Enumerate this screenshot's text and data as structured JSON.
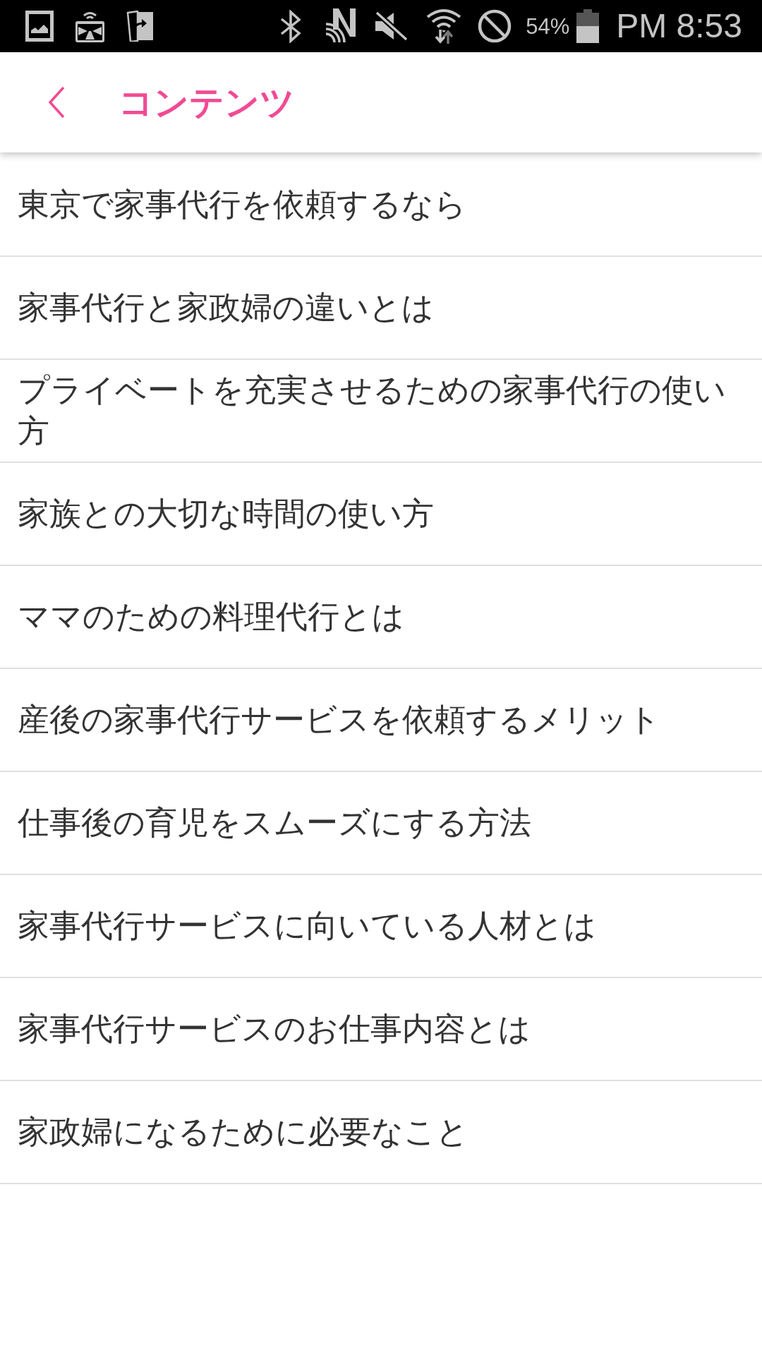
{
  "status_bar": {
    "battery_text": "54%",
    "time": "PM 8:53"
  },
  "header": {
    "title": "コンテンツ"
  },
  "items": [
    {
      "title": "東京で家事代行を依頼するなら"
    },
    {
      "title": "家事代行と家政婦の違いとは"
    },
    {
      "title": "プライベートを充実させるための家事代行の使い方"
    },
    {
      "title": "家族との大切な時間の使い方"
    },
    {
      "title": "ママのための料理代行とは"
    },
    {
      "title": "産後の家事代行サービスを依頼するメリット"
    },
    {
      "title": "仕事後の育児をスムーズにする方法"
    },
    {
      "title": "家事代行サービスに向いている人材とは"
    },
    {
      "title": "家事代行サービスのお仕事内容とは"
    },
    {
      "title": "家政婦になるために必要なこと"
    }
  ]
}
